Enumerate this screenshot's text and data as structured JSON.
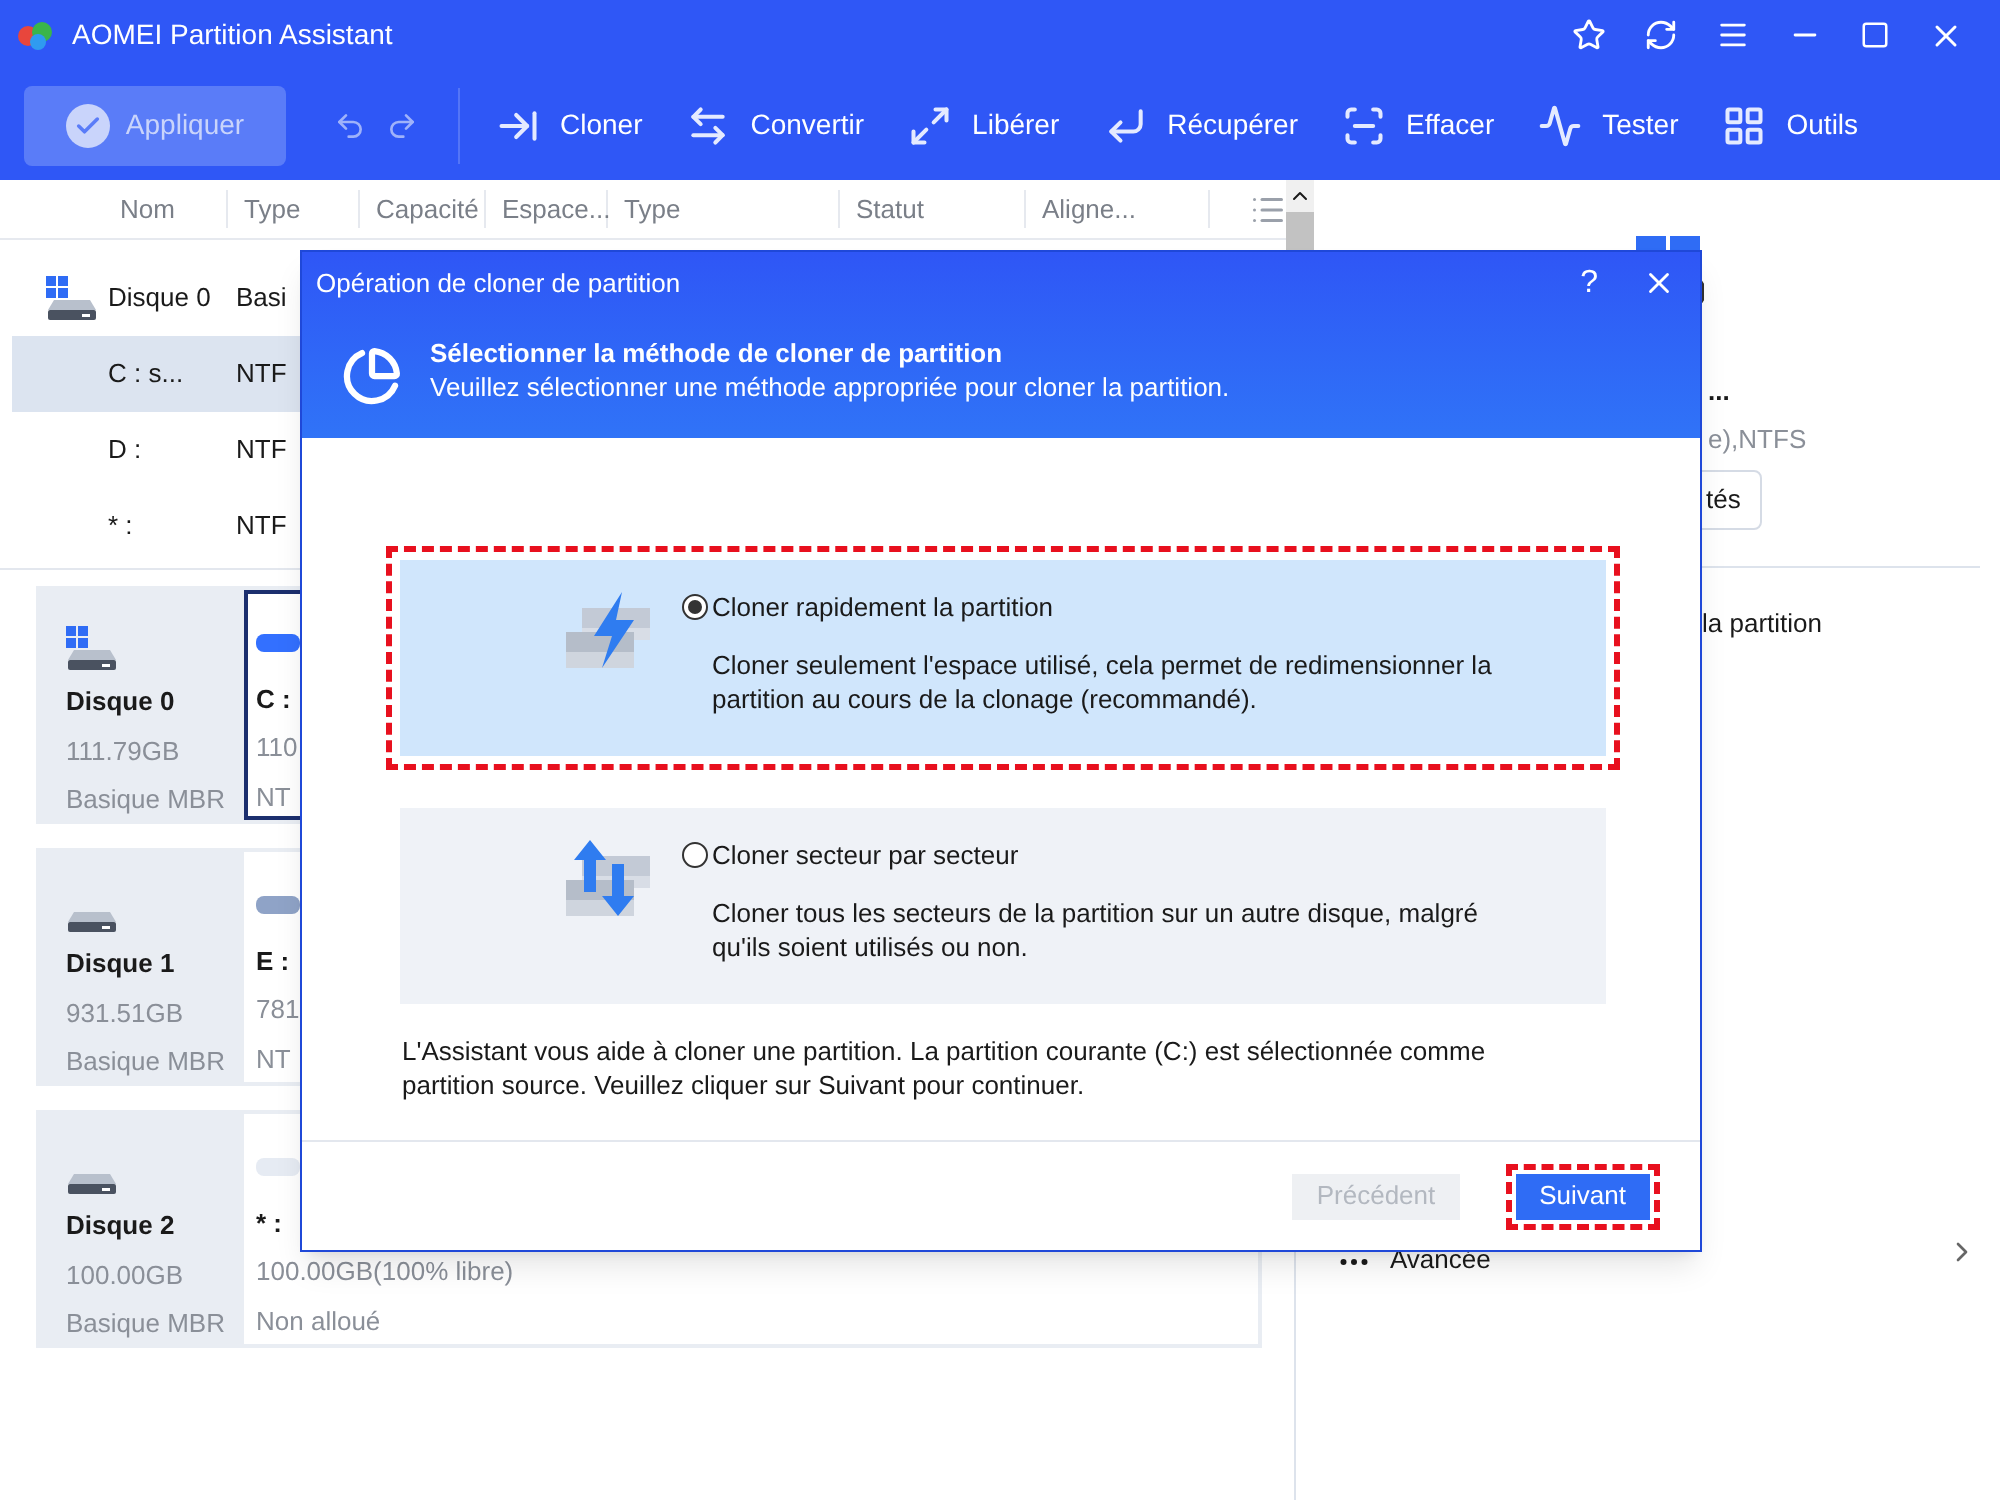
{
  "window": {
    "title": "AOMEI Partition Assistant"
  },
  "toolbar": {
    "apply": {
      "label": "Appliquer",
      "disabled": true
    },
    "items": [
      {
        "label": "Cloner"
      },
      {
        "label": "Convertir"
      },
      {
        "label": "Libérer"
      },
      {
        "label": "Récupérer"
      },
      {
        "label": "Effacer"
      },
      {
        "label": "Tester"
      },
      {
        "label": "Outils"
      }
    ]
  },
  "table": {
    "columns": [
      "Nom",
      "Type",
      "Capacité",
      "Espace...",
      "Type",
      "Statut",
      "Aligne..."
    ],
    "rows": [
      {
        "kind": "disk",
        "name": "Disque 0",
        "type": "Basi",
        "selected": false
      },
      {
        "kind": "partition",
        "name": "C : s...",
        "type": "NTF",
        "selected": true
      },
      {
        "kind": "partition",
        "name": "D :",
        "type": "NTF",
        "selected": false
      },
      {
        "kind": "partition",
        "name": "* :",
        "type": "NTF",
        "selected": false
      }
    ]
  },
  "disks": [
    {
      "name": "Disque 0",
      "size": "111.79GB",
      "style": "Basique MBR",
      "selected": true,
      "windows": true,
      "partition": {
        "label": "C :",
        "line1": "110",
        "line2": "NT",
        "color": "#3370ff"
      }
    },
    {
      "name": "Disque 1",
      "size": "931.51GB",
      "style": "Basique MBR",
      "selected": false,
      "windows": false,
      "partition": {
        "label": "E :",
        "line1": "781",
        "line2": "NT",
        "color": "#8fa3c7"
      }
    },
    {
      "name": "Disque 2",
      "size": "100.00GB",
      "style": "Basique MBR",
      "selected": false,
      "windows": false,
      "partition": {
        "label": "* :",
        "line1": "100.00GB(100% libre)",
        "line2": "Non alloué",
        "color": "#e6ebf3"
      }
    }
  ],
  "right_panel": {
    "name": "...",
    "detail": "e),NTFS",
    "button": "tés",
    "action": "la partition",
    "advanced": "Avancée"
  },
  "dialog": {
    "title": "Opération de cloner de partition",
    "help": "?",
    "heading": "Sélectionner la méthode de cloner de partition",
    "subheading": "Veuillez sélectionner une méthode appropriée pour cloner la partition.",
    "options": [
      {
        "label": "Cloner rapidement la partition",
        "description": "Cloner seulement l'espace utilisé, cela permet de redimensionner la partition au cours de la clonage (recommandé).",
        "selected": true,
        "highlighted": true
      },
      {
        "label": "Cloner secteur par secteur",
        "description": "Cloner tous les secteurs de la partition sur un autre disque, malgré qu'ils soient utilisés ou non.",
        "selected": false,
        "highlighted": false
      }
    ],
    "info": "L'Assistant vous aide à cloner une partition. La partition courante (C:) est sélectionnée comme partition source. Veuillez cliquer sur Suivant pour continuer.",
    "buttons": [
      {
        "label": "Précédent",
        "disabled": true,
        "highlighted": false
      },
      {
        "label": "Suivant",
        "disabled": false,
        "highlighted": true
      }
    ]
  }
}
